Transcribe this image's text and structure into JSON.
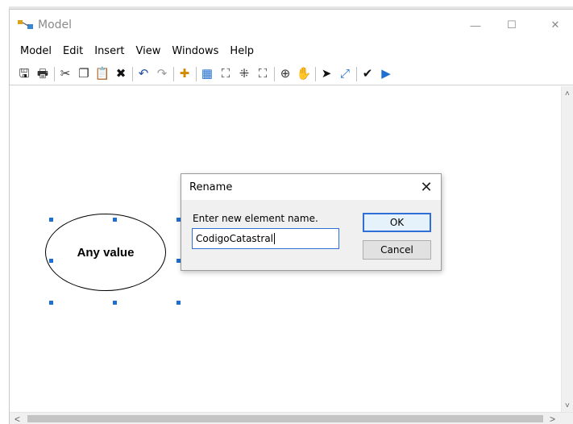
{
  "window": {
    "title": "Model",
    "minimize_symbol": "—",
    "maximize_symbol": "☐",
    "close_symbol": "✕"
  },
  "menu": {
    "items": [
      "Model",
      "Edit",
      "Insert",
      "View",
      "Windows",
      "Help"
    ]
  },
  "toolbar": {
    "icons": [
      {
        "name": "save-icon",
        "glyph": "🖫",
        "color": "#1a1a1a"
      },
      {
        "name": "print-icon",
        "glyph": "🖶",
        "color": "#333333"
      },
      {
        "sep": true
      },
      {
        "name": "cut-icon",
        "glyph": "✂",
        "color": "#333333"
      },
      {
        "name": "copy-icon",
        "glyph": "❐",
        "color": "#333333"
      },
      {
        "name": "paste-icon",
        "glyph": "📋",
        "color": "#333333"
      },
      {
        "name": "delete-icon",
        "glyph": "✖",
        "color": "#111111"
      },
      {
        "sep": true
      },
      {
        "name": "undo-icon",
        "glyph": "↶",
        "color": "#1f4fa0"
      },
      {
        "name": "redo-icon",
        "glyph": "↷",
        "color": "#9a9a9a"
      },
      {
        "sep": true
      },
      {
        "name": "add-data-icon",
        "glyph": "✚",
        "color": "#d28a00"
      },
      {
        "sep": true
      },
      {
        "name": "auto-layout-icon",
        "glyph": "▦",
        "color": "#1e6fd0"
      },
      {
        "name": "full-extent-icon",
        "glyph": "⛶",
        "color": "#333333"
      },
      {
        "name": "fixed-zoom-in-icon",
        "glyph": "⁜",
        "color": "#333333"
      },
      {
        "name": "fixed-zoom-out-icon",
        "glyph": "⛶",
        "color": "#333333"
      },
      {
        "sep": true
      },
      {
        "name": "zoom-icon",
        "glyph": "⊕",
        "color": "#333333"
      },
      {
        "name": "pan-icon",
        "glyph": "✋",
        "color": "#333333"
      },
      {
        "sep": true
      },
      {
        "name": "select-icon",
        "glyph": "➤",
        "color": "#111111"
      },
      {
        "name": "connect-icon",
        "glyph": "⤢",
        "color": "#1e6fd0"
      },
      {
        "sep": true
      },
      {
        "name": "validate-icon",
        "glyph": "✔",
        "color": "#111111"
      },
      {
        "name": "run-icon",
        "glyph": "▶",
        "color": "#1e6fd0"
      }
    ]
  },
  "canvas": {
    "element_label": "Any value"
  },
  "dialog": {
    "title": "Rename",
    "close_symbol": "✕",
    "prompt": "Enter new element name.",
    "input_value": "CodigoCatastral",
    "ok_label": "OK",
    "cancel_label": "Cancel"
  },
  "scroll": {
    "up": "˄",
    "down": "˅",
    "left": "<",
    "right": ">"
  },
  "colors": {
    "selection_handle": "#1f6fd1",
    "focus_border": "#2f6fd6"
  }
}
